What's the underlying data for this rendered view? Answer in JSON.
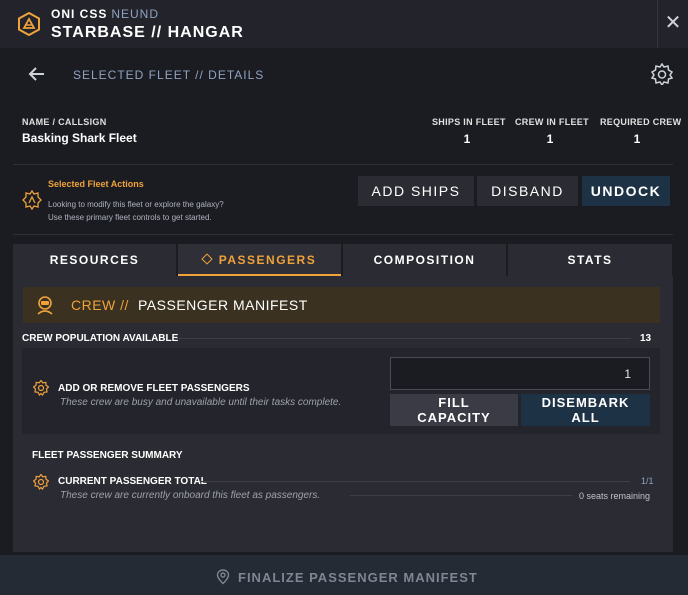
{
  "header": {
    "ship_name": "ONI CSS",
    "ship_sub": "NEUND",
    "title": "STARBASE // HANGAR",
    "close_glyph": "✕"
  },
  "subheader": {
    "breadcrumb": "SELECTED FLEET // DETAILS"
  },
  "fleet": {
    "name_label": "NAME / CALLSIGN",
    "name": "Basking Shark Fleet",
    "stats": [
      {
        "label": "SHIPS IN FLEET",
        "value": "1"
      },
      {
        "label": "CREW IN FLEET",
        "value": "1"
      },
      {
        "label": "REQUIRED CREW",
        "value": "1"
      }
    ]
  },
  "actions": {
    "title": "Selected Fleet Actions",
    "desc_line1": "Looking to modify this fleet or explore the galaxy?",
    "desc_line2": "Use these primary fleet controls to get started.",
    "buttons": [
      {
        "label": "ADD SHIPS"
      },
      {
        "label": "DISBAND"
      },
      {
        "label": "UNDOCK"
      }
    ]
  },
  "tabs": [
    {
      "label": "RESOURCES",
      "active": false
    },
    {
      "label": "PASSENGERS",
      "active": true
    },
    {
      "label": "COMPOSITION",
      "active": false
    },
    {
      "label": "STATS",
      "active": false
    }
  ],
  "manifest": {
    "crew_prefix": "CREW //",
    "title": "PASSENGER MANIFEST",
    "crew_pop_label": "CREW POPULATION AVAILABLE",
    "crew_pop_value": "13",
    "passengers": {
      "title": "ADD OR REMOVE FLEET PASSENGERS",
      "desc": "These crew are busy and unavailable until their tasks complete.",
      "input_value": "1",
      "fill_line1": "FILL",
      "fill_line2": "CAPACITY",
      "disembark_line1": "DISEMBARK",
      "disembark_line2": "ALL"
    },
    "summary": {
      "label": "FLEET PASSENGER SUMMARY",
      "current_title": "CURRENT PASSENGER TOTAL",
      "current_value": "1/1",
      "current_desc": "These crew are currently onboard this fleet as passengers.",
      "seats": "0 seats remaining"
    }
  },
  "footer": {
    "label": "FINALIZE PASSENGER MANIFEST"
  },
  "colors": {
    "accent": "#f0a23b",
    "primary_button": "#1e3246",
    "background": "#1b1c22"
  }
}
